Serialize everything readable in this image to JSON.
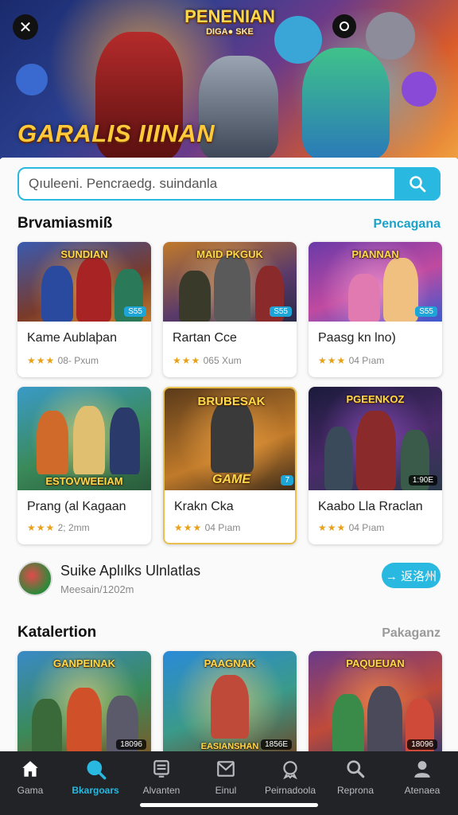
{
  "hero": {
    "logo_line1": "PENENIAN",
    "logo_line2": "DIGA● SKE",
    "title": "GARALIS IIINAN",
    "close_glyph": "✕"
  },
  "search": {
    "placeholder": "Qıuleeni. Pencraedg. suindanla"
  },
  "section1": {
    "title": "Brvamiasmiß",
    "link": "Pencagana",
    "cards": [
      {
        "thumb_label": "SUNDIAN",
        "badge": "S55",
        "title": "Kame Aublaþan",
        "stars": "★★★",
        "meta": "08- Pxum"
      },
      {
        "thumb_label": "MAID PKGUK",
        "badge": "S55",
        "title": "Rartan Cce",
        "stars": "★★★",
        "meta": "065 Xum"
      },
      {
        "thumb_label": "PIANNAN",
        "badge": "S55",
        "title": "Paasg kn lno)",
        "stars": "★★★",
        "meta": "04 Pıam"
      },
      {
        "thumb_label": "ESTOVWEEIAM",
        "badge": "",
        "title": "Prang (al Kagaan",
        "stars": "★★★",
        "meta": "2; 2mm"
      },
      {
        "thumb_label": "BRUBESAK",
        "badge": "7",
        "title": "Krakn Cka",
        "stars": "★★★",
        "meta": "04 Pıam"
      },
      {
        "thumb_label": "PGEENKOZ",
        "badge": "1:90E",
        "title": "Kaabo Lla Rraclan",
        "stars": "★★★",
        "meta": "04 Pıam"
      }
    ],
    "card4_sub_label": "GAME"
  },
  "promo": {
    "title": "Suike Aplılks Ulnlatlas",
    "subtitle": "Meesain/1202m",
    "button": "→ 返洛州"
  },
  "section2": {
    "title": "Katalertion",
    "link": "Pakaganz",
    "cards": [
      {
        "thumb_label": "GANPEINAK",
        "badge": "18096"
      },
      {
        "thumb_label": "PAAGNAK",
        "badge": "1856E",
        "bottom_label": "EASIANSHAN"
      },
      {
        "thumb_label": "PAQUEUAN",
        "badge": "18096"
      }
    ]
  },
  "tabs": [
    {
      "label": "Gama",
      "icon": "home-icon",
      "active": false
    },
    {
      "label": "Bkargoars",
      "icon": "search-icon",
      "active": true
    },
    {
      "label": "Alvanten",
      "icon": "document-icon",
      "active": false
    },
    {
      "label": "Einul",
      "icon": "mail-icon",
      "active": false
    },
    {
      "label": "Peirnadoola",
      "icon": "badge-icon",
      "active": false
    },
    {
      "label": "Reprona",
      "icon": "search-icon",
      "active": false
    },
    {
      "label": "Atenaea",
      "icon": "profile-icon",
      "active": false
    }
  ],
  "colors": {
    "accent": "#29b8e0",
    "star": "#e8a21a",
    "tabbar": "#222326"
  }
}
